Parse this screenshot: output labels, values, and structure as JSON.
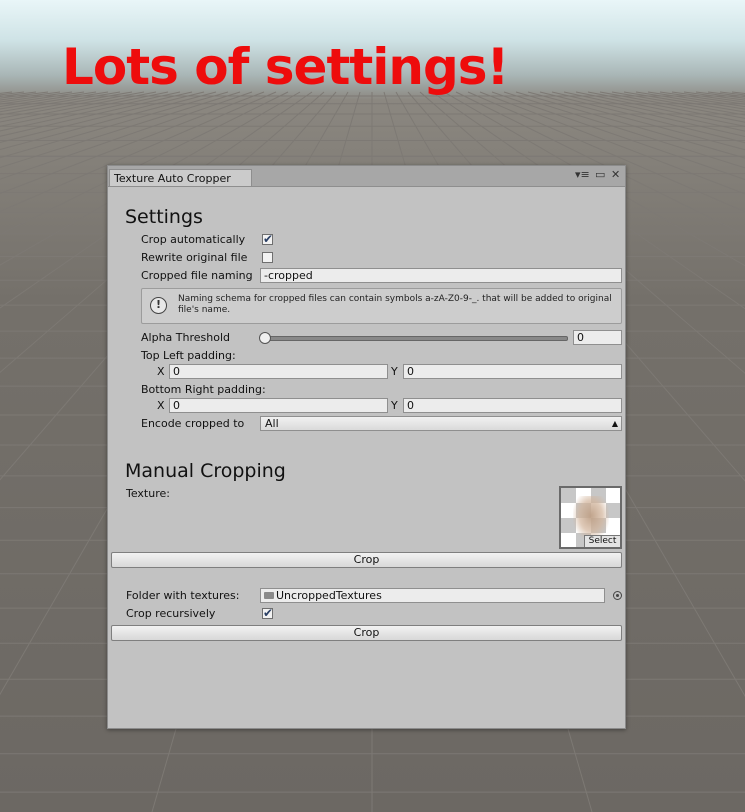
{
  "headline": "Lots of settings!",
  "window": {
    "tab_title": "Texture Auto Cropper",
    "icons": [
      "menu-icon",
      "maximize-icon",
      "close-icon"
    ]
  },
  "settings": {
    "heading": "Settings",
    "crop_automatically": {
      "label": "Crop automatically",
      "checked": true
    },
    "rewrite_original": {
      "label": "Rewrite original file",
      "checked": false
    },
    "cropped_file_naming": {
      "label": "Cropped file naming",
      "value": "-cropped"
    },
    "help_text": "Naming schema for cropped files can contain symbols a-zA-Z0-9-_. that will be added to original file's name.",
    "alpha_threshold": {
      "label": "Alpha Threshold",
      "value": "0"
    },
    "top_left_padding": {
      "label": "Top Left padding:",
      "x_label": "X",
      "x": "0",
      "y_label": "Y",
      "y": "0"
    },
    "bottom_right_padding": {
      "label": "Bottom Right padding:",
      "x_label": "X",
      "x": "0",
      "y_label": "Y",
      "y": "0"
    },
    "encode": {
      "label": "Encode cropped to",
      "value": "All"
    }
  },
  "manual": {
    "heading": "Manual Cropping",
    "texture_label": "Texture:",
    "select_label": "Select",
    "crop_button": "Crop",
    "folder_label": "Folder with textures:",
    "folder_value": "UncroppedTextures",
    "crop_recursively": {
      "label": "Crop recursively",
      "checked": true
    },
    "crop_button_2": "Crop"
  }
}
